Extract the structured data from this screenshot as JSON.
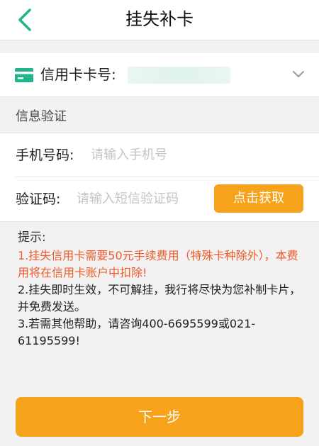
{
  "header": {
    "title": "挂失补卡",
    "back_icon": "chevron-left-icon",
    "accent_color": "#1fb48c"
  },
  "card_select": {
    "label": "信用卡卡号:",
    "icon": "credit-card-icon",
    "dropdown_icon": "chevron-down-icon"
  },
  "verify_section": {
    "title": "信息验证"
  },
  "phone_field": {
    "label": "手机号码:",
    "placeholder": "请输入手机号"
  },
  "code_field": {
    "label": "验证码:",
    "placeholder": "请输入短信验证码",
    "button_label": "点击获取"
  },
  "tips": {
    "title": "提示:",
    "items": [
      "1.挂失信用卡需要50元手续费用（特殊卡种除外），本费用将在信用卡账户中扣除!",
      "2.挂失即时生效，不可解挂，我行将尽快为您补制卡片，并免费发送。",
      "3.若需其他帮助，请咨询400-6695599或021-61195599!"
    ]
  },
  "next_button": {
    "label": "下一步"
  },
  "colors": {
    "primary_orange": "#f7a21b",
    "warning_text": "#ef5b2a"
  }
}
